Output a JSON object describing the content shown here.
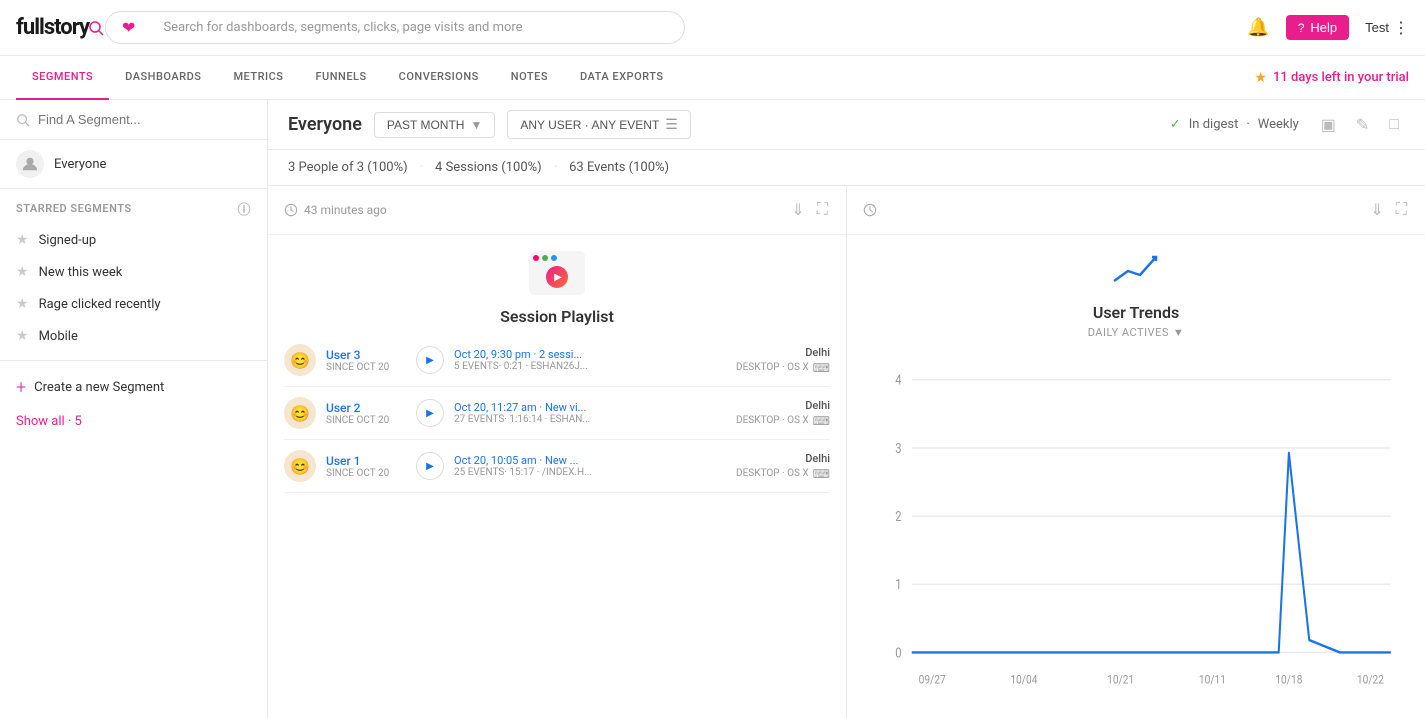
{
  "app": {
    "logo": "fullstory",
    "trial_text": "11 days left in your trial"
  },
  "search": {
    "placeholder": "Search for dashboards, segments, clicks, page visits and more"
  },
  "topright": {
    "help_label": "Help",
    "test_label": "Test"
  },
  "nav": {
    "tabs": [
      {
        "id": "segments",
        "label": "SEGMENTS",
        "active": true
      },
      {
        "id": "dashboards",
        "label": "DASHBOARDS",
        "active": false
      },
      {
        "id": "metrics",
        "label": "METRICS",
        "active": false
      },
      {
        "id": "funnels",
        "label": "FUNNELS",
        "active": false
      },
      {
        "id": "conversions",
        "label": "CONVERSIONS",
        "active": false
      },
      {
        "id": "notes",
        "label": "NOTES",
        "active": false
      },
      {
        "id": "data-exports",
        "label": "DATA EXPORTS",
        "active": false
      }
    ]
  },
  "sidebar": {
    "search_placeholder": "Find A Segment...",
    "everyone_label": "Everyone",
    "starred_header": "STARRED SEGMENTS",
    "segments": [
      {
        "id": "signed-up",
        "label": "Signed-up"
      },
      {
        "id": "new-this-week",
        "label": "New this week"
      },
      {
        "id": "rage-clicked",
        "label": "Rage clicked recently"
      },
      {
        "id": "mobile",
        "label": "Mobile"
      }
    ],
    "create_label": "Create a new Segment",
    "show_all": "Show all · 5"
  },
  "segment": {
    "title": "Everyone",
    "filter_time": "PAST MONTH",
    "filter_event": "ANY USER · ANY EVENT",
    "digest_label": "In digest",
    "digest_period": "Weekly",
    "stats": {
      "people": "3 People of 3 (100%)",
      "sessions": "4 Sessions (100%)",
      "events": "63 Events (100%)"
    }
  },
  "session_panel": {
    "last_updated": "43 minutes ago",
    "title": "Session Playlist",
    "sessions": [
      {
        "user": "User 3",
        "since": "SINCE OCT 20",
        "time": "Oct 20, 9:30 pm",
        "detail": "2 sessi...",
        "meta": "5 EVENTS· 0:21 · ESHAN26J...",
        "location": "Delhi",
        "device": "DESKTOP · OS X"
      },
      {
        "user": "User 2",
        "since": "SINCE OCT 20",
        "time": "Oct 20, 11:27 am",
        "detail": "New vi...",
        "meta": "27 EVENTS· 1:16:14 · ESHAN...",
        "location": "Delhi",
        "device": "DESKTOP · OS X"
      },
      {
        "user": "User 1",
        "since": "SINCE OCT 20",
        "time": "Oct 20, 10:05 am",
        "detail": "New ...",
        "meta": "25 EVENTS· 15:17 · /INDEX.H...",
        "location": "Delhi",
        "device": "DESKTOP · OS X"
      }
    ]
  },
  "trends_panel": {
    "title": "User Trends",
    "subtitle": "DAILY ACTIVES",
    "chart": {
      "x_labels": [
        "09/27",
        "10/04",
        "10/21",
        "10/11",
        "10/18",
        "10/22"
      ],
      "y_labels": [
        "0",
        "1",
        "2",
        "3",
        "4"
      ],
      "peak_date": "10/18",
      "peak_value": 3,
      "data_points": [
        {
          "x": 0,
          "y": 0
        },
        {
          "x": 0.15,
          "y": 0
        },
        {
          "x": 0.3,
          "y": 0
        },
        {
          "x": 0.45,
          "y": 0
        },
        {
          "x": 0.6,
          "y": 0
        },
        {
          "x": 0.65,
          "y": 0
        },
        {
          "x": 0.75,
          "y": 0.1
        },
        {
          "x": 0.78,
          "y": 3
        },
        {
          "x": 0.82,
          "y": 0.2
        },
        {
          "x": 0.9,
          "y": 0
        },
        {
          "x": 1,
          "y": 0
        }
      ]
    }
  },
  "colors": {
    "accent": "#e91e8c",
    "blue": "#1a73e8",
    "green": "#4caf50",
    "gold": "#f5a623",
    "chart_line": "#1a73e8",
    "grid": "#e8e8e8"
  }
}
